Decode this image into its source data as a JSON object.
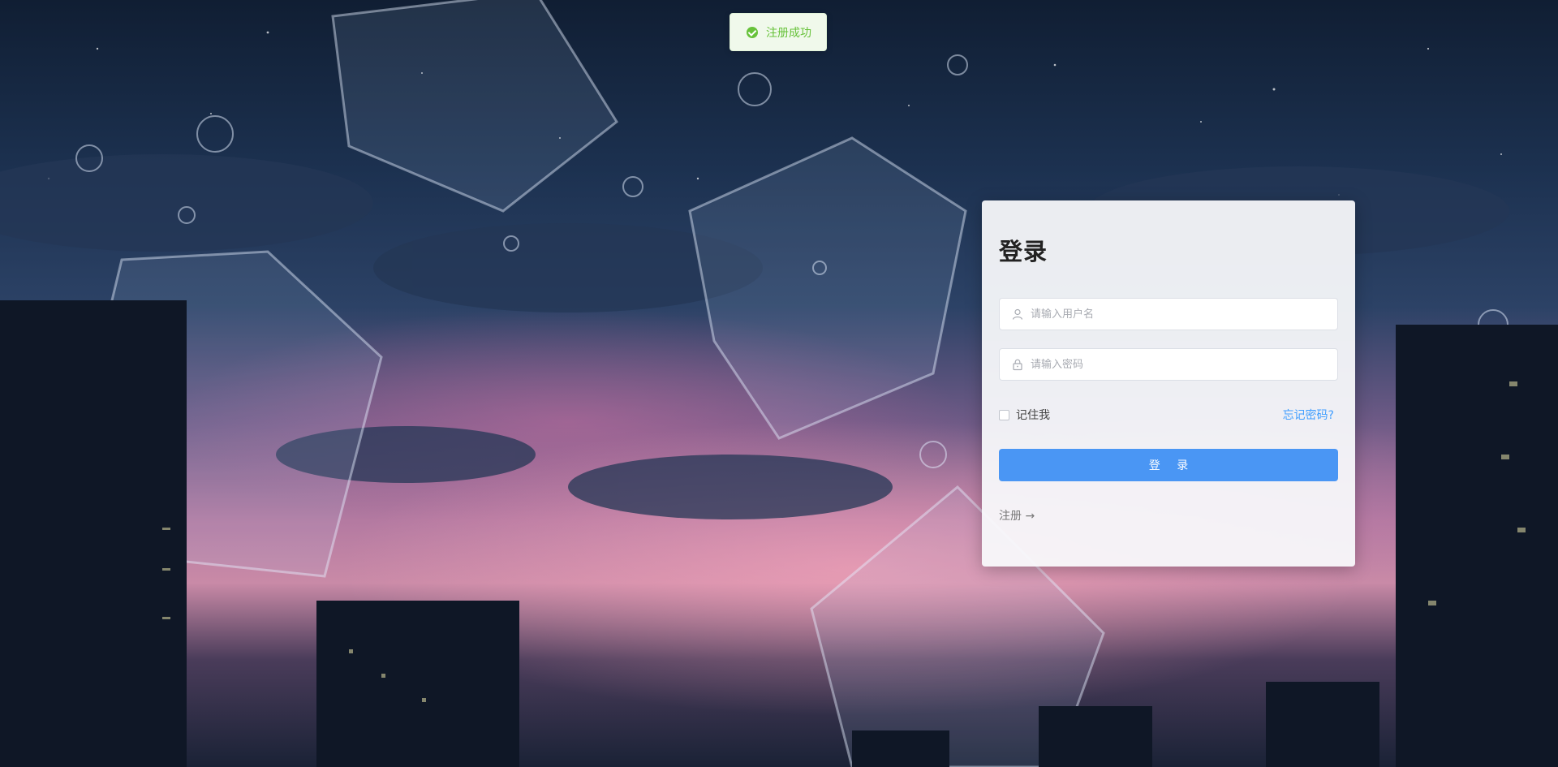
{
  "toast": {
    "message": "注册成功",
    "icon": "success-check-icon",
    "color": "#67c23a"
  },
  "login": {
    "title": "登录",
    "username_placeholder": "请输入用户名",
    "password_placeholder": "请输入密码",
    "remember_label": "记住我",
    "forgot_label": "忘记密码?",
    "submit_label": "登 录",
    "register_label": "注册 →"
  },
  "colors": {
    "accent": "#409eff",
    "button": "#4a96f4"
  }
}
